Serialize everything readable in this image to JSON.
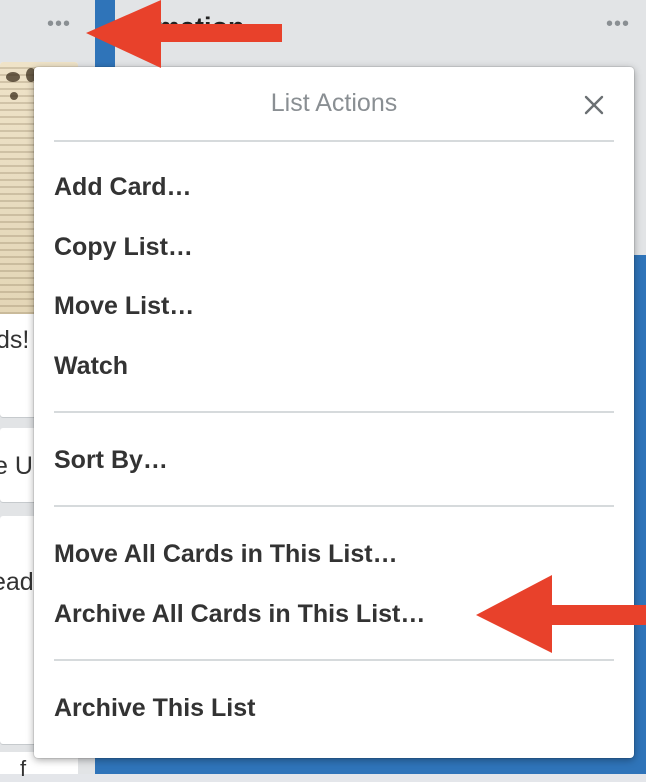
{
  "board": {
    "list_title": "formation",
    "left_card_text_1": "ds!",
    "left_card_text_2": "e U",
    "left_card_text_3": "ead",
    "left_card_text_4": "f"
  },
  "icons": {
    "list_menu_left": "ellipsis-icon",
    "list_menu_right": "ellipsis-icon",
    "close": "close-icon"
  },
  "popup": {
    "title": "List Actions",
    "items": [
      {
        "label": "Add Card…"
      },
      {
        "label": "Copy List…"
      },
      {
        "label": "Move List…"
      },
      {
        "label": "Watch"
      },
      {
        "label": "Sort By…"
      },
      {
        "label": "Move All Cards in This List…"
      },
      {
        "label": "Archive All Cards in This List…"
      },
      {
        "label": "Archive This List"
      }
    ]
  },
  "colors": {
    "annotation_arrow": "#e8412b",
    "board_blue": "#2f74b9",
    "list_gray": "#e2e4e6"
  }
}
